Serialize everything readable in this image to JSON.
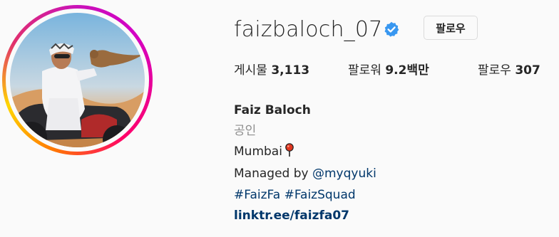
{
  "profile": {
    "username": "faizbaloch_07",
    "verified": true,
    "follow_label": "팔로우",
    "avatar_alt": "profile photo"
  },
  "stats": {
    "posts_label": "게시물",
    "posts_value": "3,113",
    "followers_label": "팔로워",
    "followers_value": "9.2백만",
    "following_label": "팔로우",
    "following_value": "307"
  },
  "bio": {
    "full_name": "Faiz Baloch",
    "category": "공인",
    "location": "Mumbai",
    "managed_prefix": "Managed by",
    "managed_handle": "@myqyuki",
    "hashtag_1": "#FaizFa",
    "hashtag_2": "#FaizSquad",
    "link": "linktr.ee/faizfa07"
  },
  "colors": {
    "verified_blue": "#3897f0",
    "link_blue": "#00376b",
    "muted_gray": "#8e8e8e"
  },
  "icons": {
    "verified": "verified-badge-icon",
    "location": "round-pushpin-icon"
  }
}
